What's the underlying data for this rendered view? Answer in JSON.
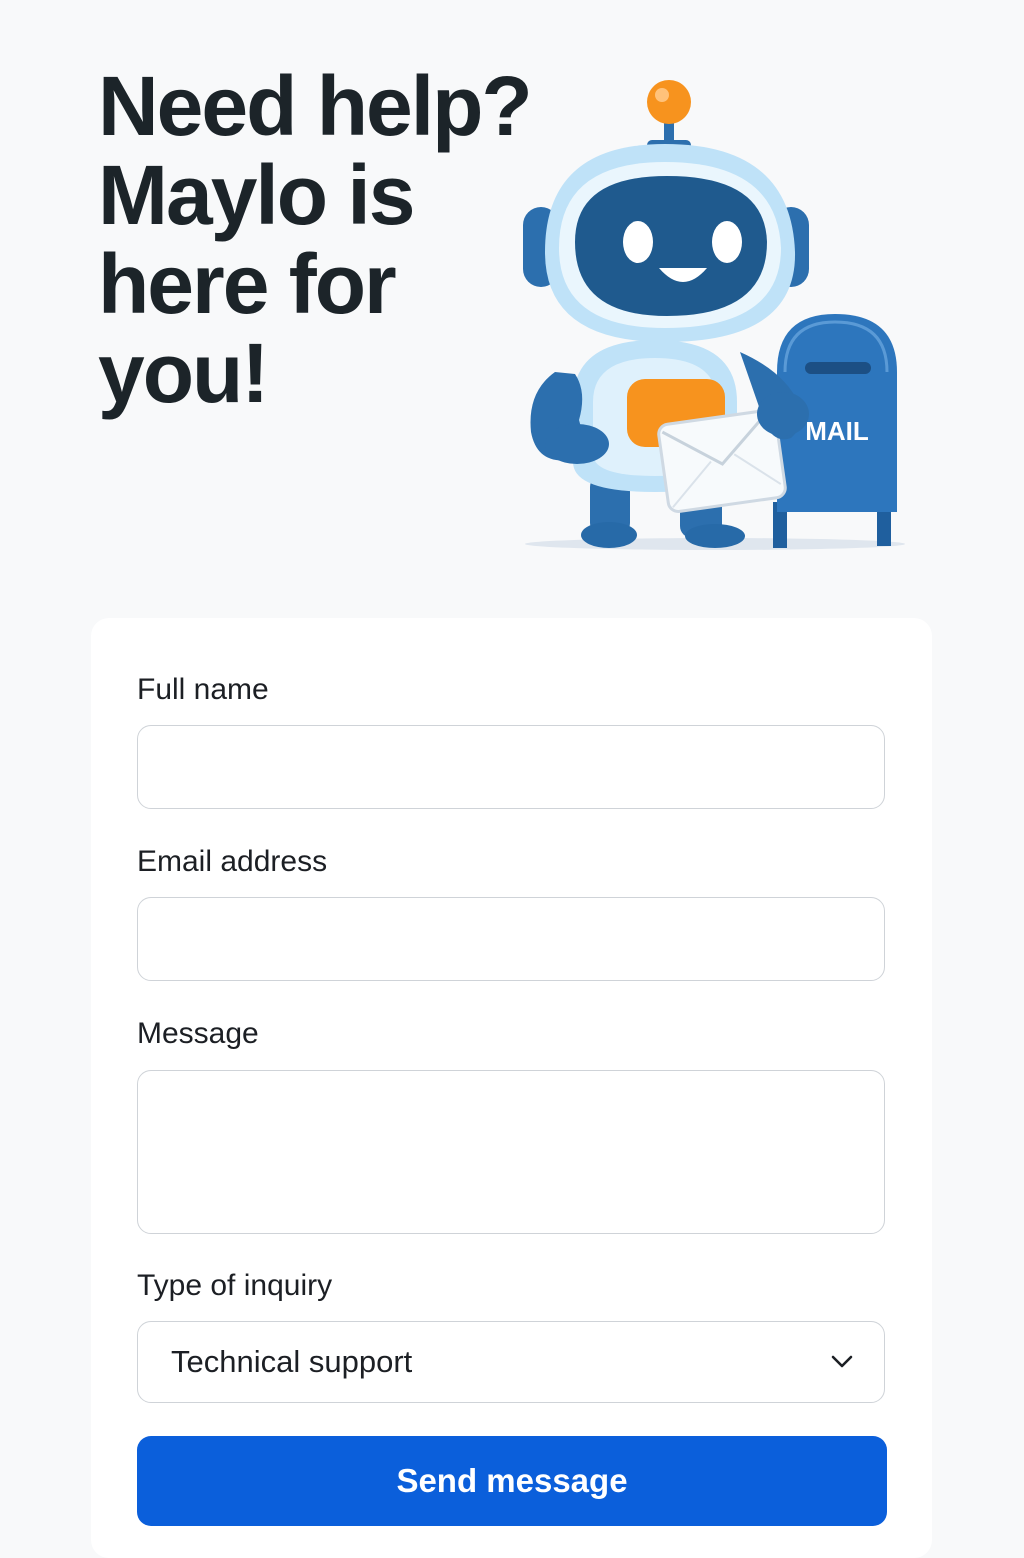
{
  "hero": {
    "title": "Need help? Maylo is here for you!",
    "mascot_mailbox_text": "MAIL"
  },
  "form": {
    "full_name": {
      "label": "Full name",
      "value": "",
      "placeholder": ""
    },
    "email": {
      "label": "Email address",
      "value": "",
      "placeholder": ""
    },
    "message": {
      "label": "Message",
      "value": "",
      "placeholder": ""
    },
    "inquiry_type": {
      "label": "Type of inquiry",
      "selected": "Technical support"
    },
    "submit_label": "Send message"
  },
  "icons": {
    "select_chevron": "chevron-down-icon",
    "mascot": "robot-mascot-icon",
    "envelope": "envelope-icon",
    "mailbox": "mailbox-icon"
  },
  "colors": {
    "page_background": "#f8f9fa",
    "card_background": "#ffffff",
    "primary_button": "#0b5fdb",
    "heading_text": "#1c2429",
    "mascot_blue": "#2c6fae",
    "mascot_light_blue": "#bfe2f8",
    "mascot_orange": "#f7931e"
  }
}
